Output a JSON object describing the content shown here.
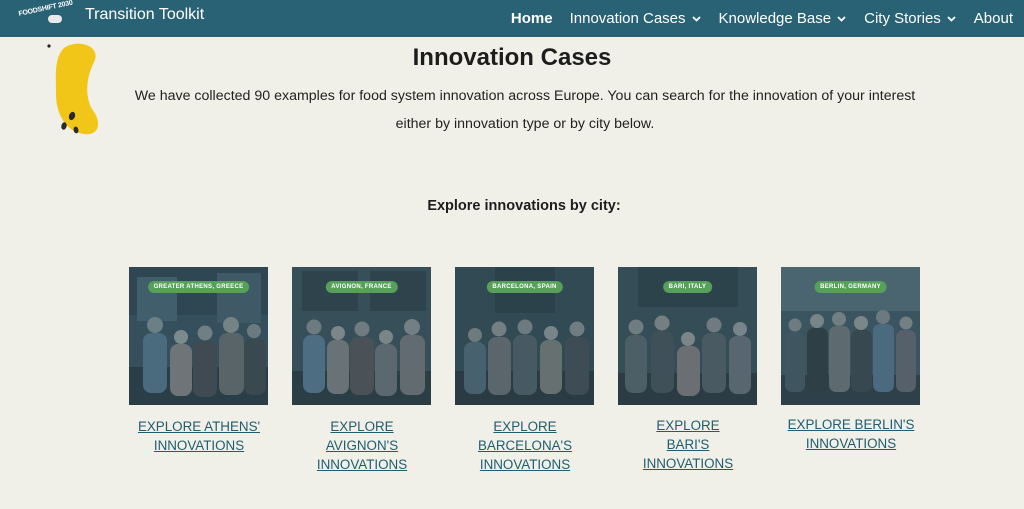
{
  "header": {
    "logo_text": "FOODSHIFT 2030",
    "site_title": "Transition Toolkit",
    "nav": [
      {
        "label": "Home",
        "active": true,
        "dropdown": false
      },
      {
        "label": "Innovation Cases",
        "active": false,
        "dropdown": true
      },
      {
        "label": "Knowledge Base",
        "active": false,
        "dropdown": true
      },
      {
        "label": "City Stories",
        "active": false,
        "dropdown": true
      },
      {
        "label": "About",
        "active": false,
        "dropdown": false
      }
    ]
  },
  "main": {
    "title": "Innovation Cases",
    "intro": "We have collected 90 examples for food system innovation across Europe. You can search for the innovation of your interest either by innovation type or by city below.",
    "cities_heading": "Explore innovations by city:",
    "cities": [
      {
        "tag": "GREATER ATHENS, GREECE",
        "link_lines": [
          "EXPLORE ATHENS'",
          "INNOVATIONS"
        ]
      },
      {
        "tag": "AVIGNON, FRANCE",
        "link_lines": [
          "EXPLORE",
          "AVIGNON'S",
          "INNOVATIONS"
        ]
      },
      {
        "tag": "BARCELONA, SPAIN",
        "link_lines": [
          "EXPLORE",
          "BARCELONA'S",
          "INNOVATIONS"
        ]
      },
      {
        "tag": "BARI, ITALY",
        "link_lines": [
          "EXPLORE",
          "BARI'S",
          "INNOVATIONS"
        ]
      },
      {
        "tag": "BERLIN, GERMANY",
        "link_lines": [
          "EXPLORE BERLIN'S",
          "INNOVATIONS"
        ]
      }
    ]
  },
  "colors": {
    "nav_bg": "#2a6275",
    "page_bg": "#f1f0e8",
    "link": "#1f5d6f",
    "tag_green": "#57a05a",
    "banana_yellow": "#f2c618"
  },
  "icons": [
    "chevron-down-icon",
    "banana-illustration"
  ]
}
